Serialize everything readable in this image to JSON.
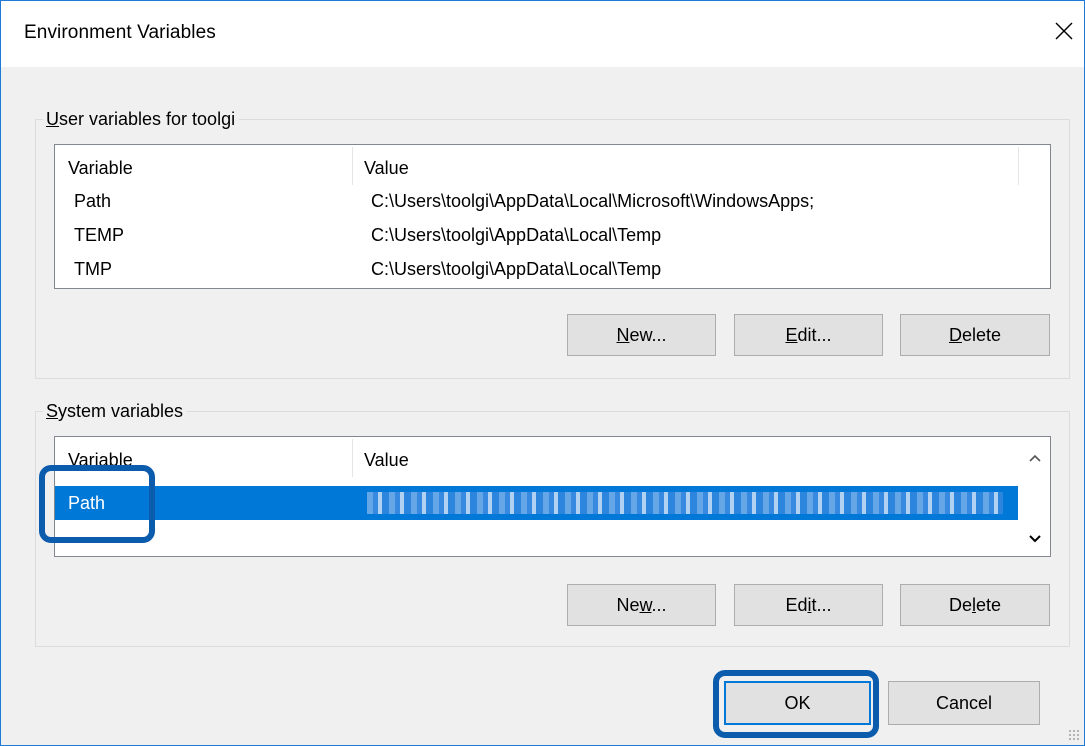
{
  "window": {
    "title": "Environment Variables"
  },
  "user_group": {
    "label": "User variables for toolgi",
    "label_access_index": 0,
    "columns": [
      "Variable",
      "Value"
    ],
    "rows": [
      {
        "variable": "Path",
        "value": "C:\\Users\\toolgi\\AppData\\Local\\Microsoft\\WindowsApps;"
      },
      {
        "variable": "TEMP",
        "value": "C:\\Users\\toolgi\\AppData\\Local\\Temp"
      },
      {
        "variable": "TMP",
        "value": "C:\\Users\\toolgi\\AppData\\Local\\Temp"
      }
    ],
    "buttons": {
      "new": "New...",
      "edit": "Edit...",
      "delete": "Delete"
    }
  },
  "system_group": {
    "label": "System variables",
    "columns": [
      "Variable",
      "Value"
    ],
    "rows": [
      {
        "variable": "Path",
        "selected": true
      }
    ],
    "buttons": {
      "new": "New...",
      "edit": "Edit...",
      "delete": "Delete"
    }
  },
  "footer": {
    "ok": "OK",
    "cancel": "Cancel"
  },
  "colors": {
    "selection": "#0078d7",
    "annotation": "#0b5cad",
    "window_border": "#1e7ad6"
  },
  "icons": {
    "close": "close-icon",
    "scroll_up": "chevron-up-icon",
    "scroll_down": "chevron-down-icon"
  }
}
